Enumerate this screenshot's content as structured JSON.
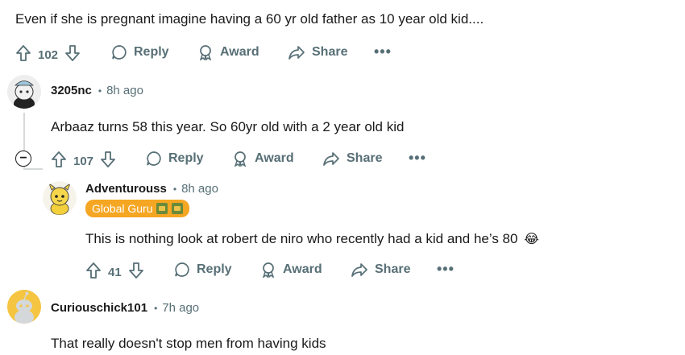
{
  "top_comment": {
    "text": "Even if she is pregnant imagine having a 60 yr old father as 10 year old kid....",
    "votes": "102",
    "reply_label": "Reply",
    "award_label": "Award",
    "share_label": "Share",
    "more_label": "•••"
  },
  "comment_1": {
    "username": "3205nc",
    "time": "8h ago",
    "text": "Arbaaz turns 58 this year. So 60yr old with a 2 year old kid",
    "votes": "107",
    "reply_label": "Reply",
    "award_label": "Award",
    "share_label": "Share",
    "more_label": "•••",
    "collapse_label": "−"
  },
  "reply_1": {
    "username": "Adventurouss",
    "time": "8h ago",
    "flair": "Global Guru",
    "text": "This is nothing look at robert de niro who recently had a kid and he’s 80",
    "emoji": "😂",
    "votes": "41",
    "reply_label": "Reply",
    "award_label": "Award",
    "share_label": "Share",
    "more_label": "•••"
  },
  "comment_2": {
    "username": "Curiouschick101",
    "time": "7h ago",
    "text": "That really doesn't stop men from having kids"
  },
  "separator": "•",
  "colors": {
    "text": "#1a1a1b",
    "meta": "#576f76",
    "flair": "#f5a623",
    "thread_line": "#d6dadb"
  }
}
